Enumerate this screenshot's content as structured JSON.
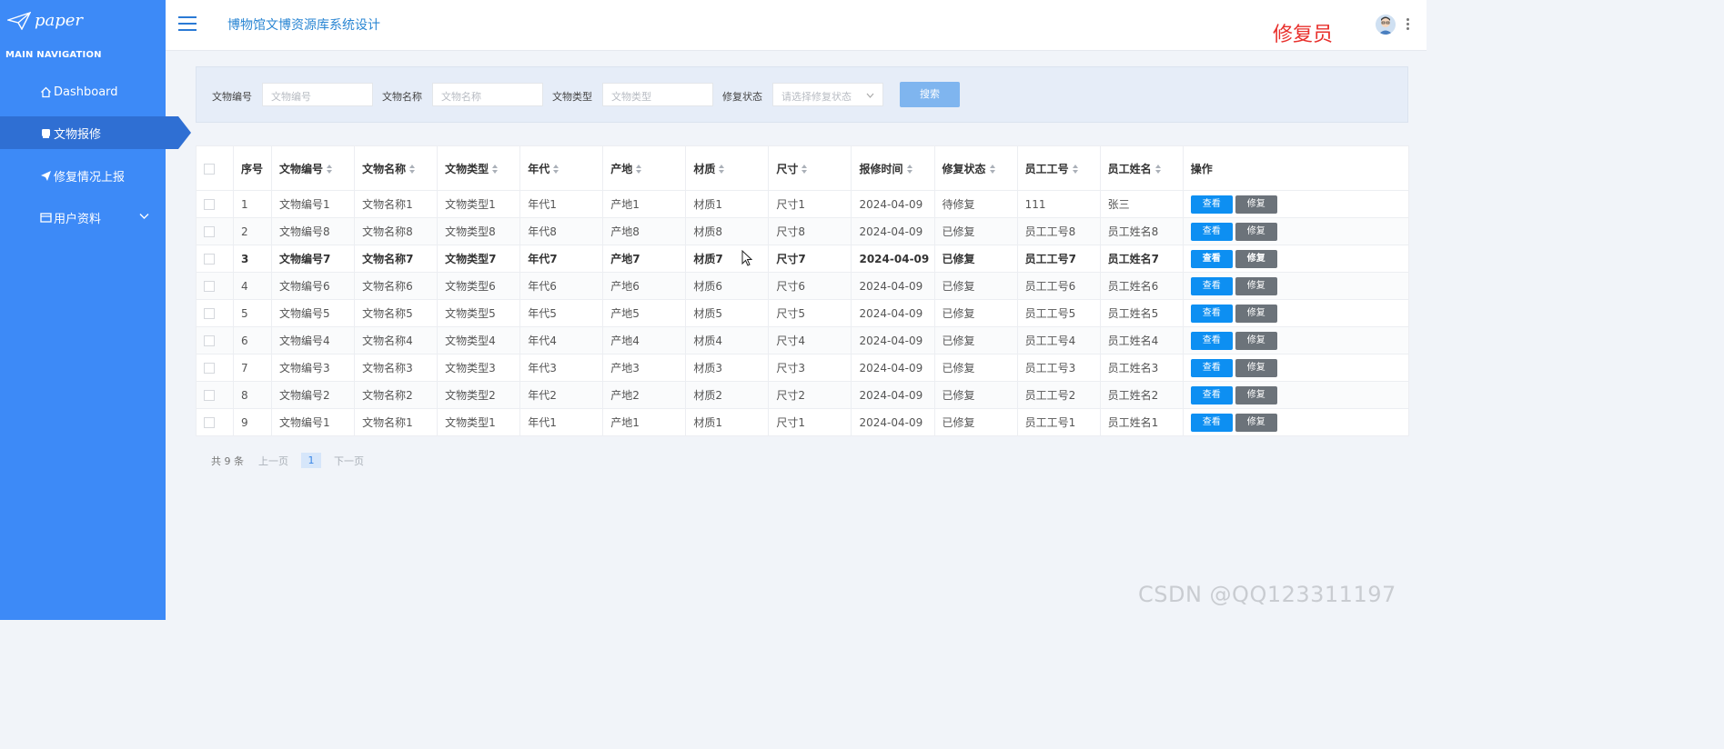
{
  "app": {
    "logo_text": "paper",
    "nav_title": "MAIN NAVIGATION",
    "system_title": "博物馆文博资源库系统设计",
    "role_label": "修复员"
  },
  "sidebar": {
    "items": [
      {
        "label": "Dashboard",
        "icon": "home-icon"
      },
      {
        "label": "文物报修",
        "icon": "repair-icon",
        "active": true
      },
      {
        "label": "修复情况上报",
        "icon": "send-icon"
      },
      {
        "label": "用户资料",
        "icon": "profile-icon",
        "expandable": true
      }
    ]
  },
  "search": {
    "code_label": "文物编号",
    "code_placeholder": "文物编号",
    "name_label": "文物名称",
    "name_placeholder": "文物名称",
    "type_label": "文物类型",
    "type_placeholder": "文物类型",
    "status_label": "修复状态",
    "status_placeholder": "请选择修复状态",
    "button": "搜索"
  },
  "table": {
    "columns": [
      "序号",
      "文物编号",
      "文物名称",
      "文物类型",
      "年代",
      "产地",
      "材质",
      "尺寸",
      "报修时间",
      "修复状态",
      "员工工号",
      "员工姓名",
      "操作"
    ],
    "rows": [
      [
        "1",
        "文物编号1",
        "文物名称1",
        "文物类型1",
        "年代1",
        "产地1",
        "材质1",
        "尺寸1",
        "2024-04-09",
        "待修复",
        "111",
        "张三"
      ],
      [
        "2",
        "文物编号8",
        "文物名称8",
        "文物类型8",
        "年代8",
        "产地8",
        "材质8",
        "尺寸8",
        "2024-04-09",
        "已修复",
        "员工工号8",
        "员工姓名8"
      ],
      [
        "3",
        "文物编号7",
        "文物名称7",
        "文物类型7",
        "年代7",
        "产地7",
        "材质7",
        "尺寸7",
        "2024-04-09",
        "已修复",
        "员工工号7",
        "员工姓名7"
      ],
      [
        "4",
        "文物编号6",
        "文物名称6",
        "文物类型6",
        "年代6",
        "产地6",
        "材质6",
        "尺寸6",
        "2024-04-09",
        "已修复",
        "员工工号6",
        "员工姓名6"
      ],
      [
        "5",
        "文物编号5",
        "文物名称5",
        "文物类型5",
        "年代5",
        "产地5",
        "材质5",
        "尺寸5",
        "2024-04-09",
        "已修复",
        "员工工号5",
        "员工姓名5"
      ],
      [
        "6",
        "文物编号4",
        "文物名称4",
        "文物类型4",
        "年代4",
        "产地4",
        "材质4",
        "尺寸4",
        "2024-04-09",
        "已修复",
        "员工工号4",
        "员工姓名4"
      ],
      [
        "7",
        "文物编号3",
        "文物名称3",
        "文物类型3",
        "年代3",
        "产地3",
        "材质3",
        "尺寸3",
        "2024-04-09",
        "已修复",
        "员工工号3",
        "员工姓名3"
      ],
      [
        "8",
        "文物编号2",
        "文物名称2",
        "文物类型2",
        "年代2",
        "产地2",
        "材质2",
        "尺寸2",
        "2024-04-09",
        "已修复",
        "员工工号2",
        "员工姓名2"
      ],
      [
        "9",
        "文物编号1",
        "文物名称1",
        "文物类型1",
        "年代1",
        "产地1",
        "材质1",
        "尺寸1",
        "2024-04-09",
        "已修复",
        "员工工号1",
        "员工姓名1"
      ]
    ],
    "view_label": "查看",
    "repair_label": "修复"
  },
  "pager": {
    "total": "共 9 条",
    "prev": "上一页",
    "current": "1",
    "next": "下一页"
  },
  "watermark": "CSDN @QQ123311197",
  "colors": {
    "sidebar": "#3d8af7",
    "accent": "#2a86d3",
    "role": "#e8302c",
    "view_button": "#0d8ff2",
    "repair_button": "#6c737a"
  }
}
